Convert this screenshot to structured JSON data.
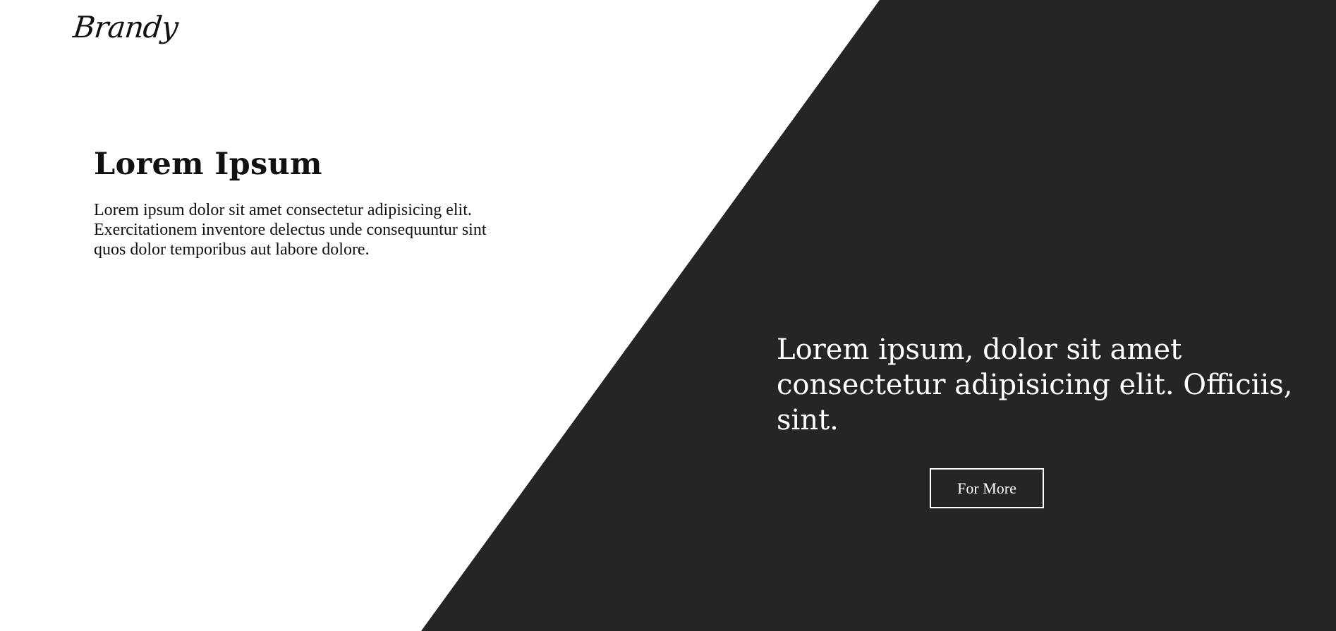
{
  "brand": {
    "logo_text": "Brandy"
  },
  "intro": {
    "title": "Lorem Ipsum",
    "body": "Lorem ipsum dolor sit amet consectetur adipisicing elit. Exercitationem inventore delectus unde consequuntur sint quos dolor temporibus aut labore dolore."
  },
  "feature": {
    "tagline": "Lorem ipsum, dolor sit amet consectetur adipisicing elit. Officiis, sint.",
    "button_label": "For More"
  },
  "colors": {
    "background": "#ffffff",
    "dark_panel": "#252525",
    "text_dark": "#111111",
    "text_light": "#ffffff"
  }
}
